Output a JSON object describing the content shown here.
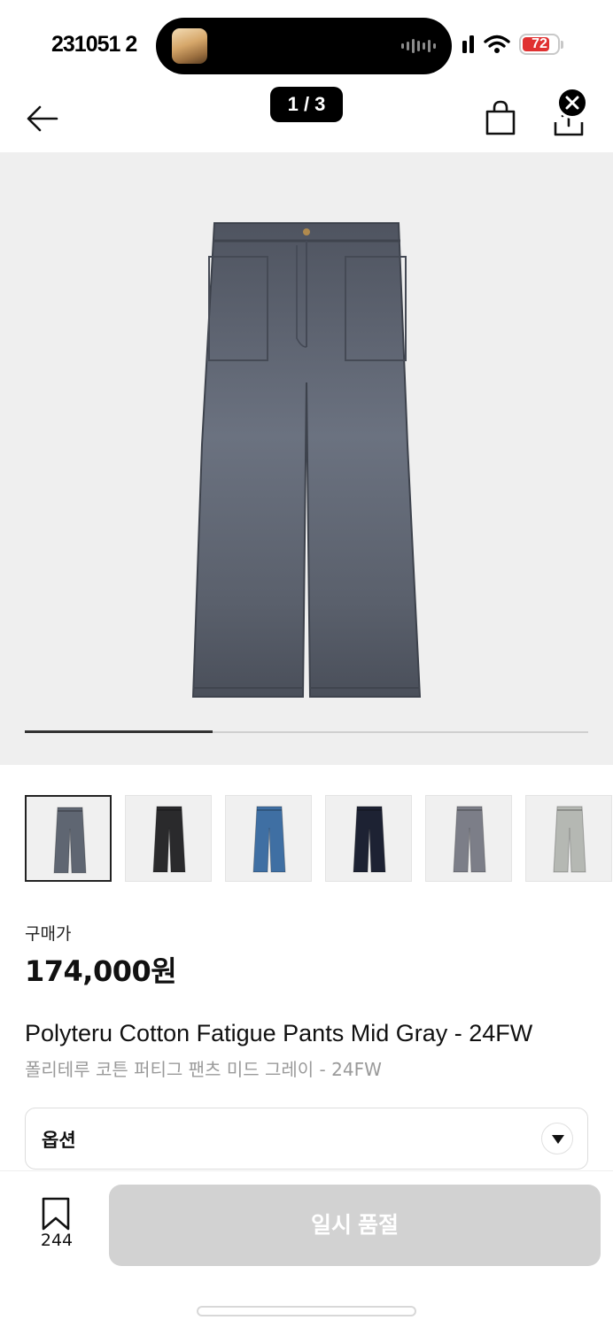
{
  "status_bar": {
    "time": "231051 2",
    "battery": "72"
  },
  "header": {
    "image_counter": "1 / 3"
  },
  "gallery": {
    "current_index": 1,
    "total": 3,
    "product_color": "#5f6672"
  },
  "thumbnails": [
    {
      "name": "Mid Gray",
      "color": "#5f6672",
      "active": true
    },
    {
      "name": "Black",
      "color": "#2a2a2c",
      "active": false
    },
    {
      "name": "Blue",
      "color": "#3f6fa3",
      "active": false
    },
    {
      "name": "Navy",
      "color": "#1d2233",
      "active": false
    },
    {
      "name": "Gray",
      "color": "#7c7e88",
      "active": false
    },
    {
      "name": "Light Gray",
      "color": "#b5b8b3",
      "active": false
    }
  ],
  "product": {
    "price_label": "구매가",
    "price": "174,000원",
    "name_en": "Polyteru Cotton Fatigue Pants Mid Gray - 24FW",
    "name_ko": "폴리테루 코튼 퍼티그 팬츠 미드 그레이 - 24FW"
  },
  "option": {
    "label": "옵션"
  },
  "bottom_bar": {
    "bookmark_count": "244",
    "buy_button": "일시 품절"
  },
  "icons": {
    "back": "arrow-left-icon",
    "cart": "shopping-bag-icon",
    "share": "share-icon",
    "close": "close-icon",
    "bookmark": "bookmark-icon",
    "chevron": "chevron-down-icon"
  }
}
